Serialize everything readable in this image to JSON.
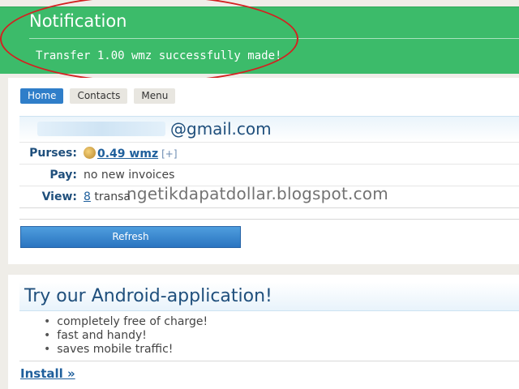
{
  "notification": {
    "title": "Notification",
    "message": "Transfer 1.00 wmz successfully made!"
  },
  "nav": {
    "items": [
      {
        "label": "Home",
        "active": true
      },
      {
        "label": "Contacts",
        "active": false
      },
      {
        "label": "Menu",
        "active": false
      }
    ]
  },
  "account": {
    "email_suffix": "@gmail.com",
    "purses": {
      "label": "Purses:",
      "amount": "0.49 wmz",
      "add": "[+]"
    },
    "pay": {
      "label": "Pay:",
      "value": "no new invoices"
    },
    "view": {
      "label": "View:",
      "count": "8",
      "text": " transa"
    }
  },
  "watermark": "ngetikdapatdollar.blogspot.com",
  "refresh_label": "Refresh",
  "android": {
    "title": "Try our Android-application!",
    "features": [
      "completely free of charge!",
      "fast and handy!",
      "saves mobile traffic!"
    ],
    "install_label": "Install »"
  },
  "colors": {
    "notification_bg": "#3cbb6a",
    "accent_blue": "#2f7ec9",
    "annotation_red": "#d42020"
  }
}
